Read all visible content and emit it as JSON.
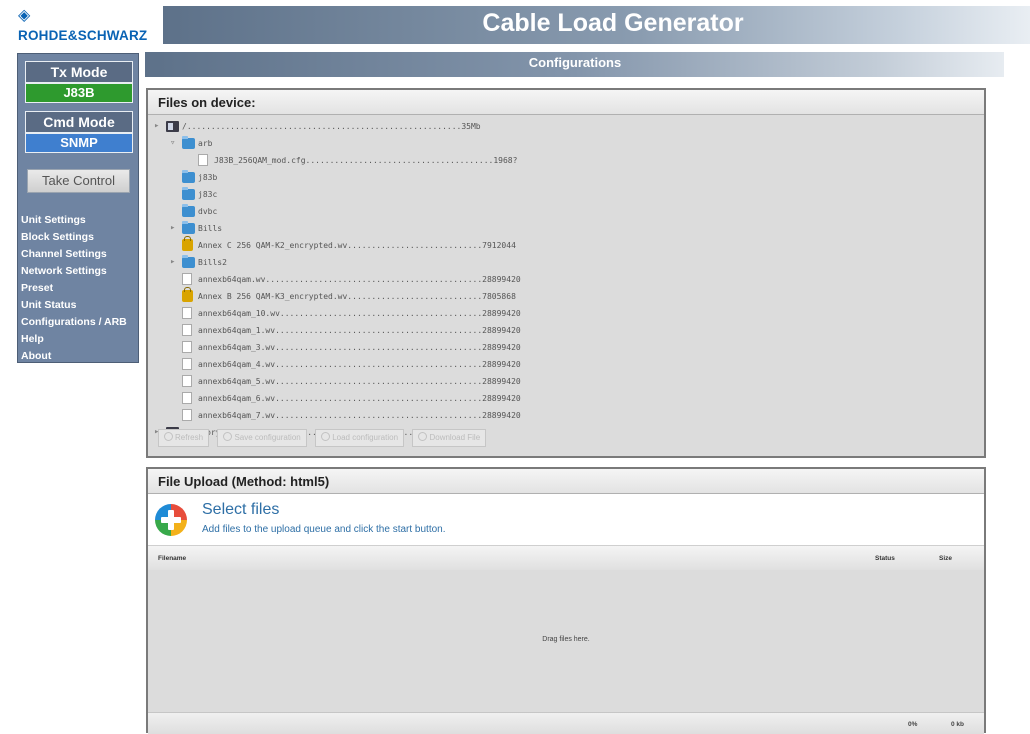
{
  "brand": {
    "logo_text": "ROHDE&SCHWARZ"
  },
  "header": {
    "title": "Cable Load Generator"
  },
  "sidebar": {
    "tx_mode_label": "Tx Mode",
    "tx_mode_value": "J83B",
    "cmd_mode_label": "Cmd Mode",
    "cmd_mode_value": "SNMP",
    "take_control_label": "Take Control",
    "nav": [
      "Unit Settings",
      "Block Settings",
      "Channel Settings",
      "Network Settings",
      "Preset",
      "Unit Status",
      "Configurations / ARB",
      "Help",
      "About"
    ]
  },
  "page": {
    "section_title": "Configurations"
  },
  "files_panel": {
    "title": "Files on device:",
    "tree": [
      {
        "indent": 0,
        "toggle": "▸",
        "icon": "drive",
        "label": "/.........................................................35Mb"
      },
      {
        "indent": 1,
        "toggle": "▿",
        "icon": "folder",
        "label": "arb"
      },
      {
        "indent": 2,
        "toggle": "",
        "icon": "file",
        "label": "J83B_256QAM_mod.cfg.......................................1968?"
      },
      {
        "indent": 1,
        "toggle": "",
        "icon": "folder",
        "label": "j83b"
      },
      {
        "indent": 1,
        "toggle": "",
        "icon": "folder",
        "label": "j83c"
      },
      {
        "indent": 1,
        "toggle": "",
        "icon": "folder",
        "label": "dvbc"
      },
      {
        "indent": 1,
        "toggle": "▸",
        "icon": "folder",
        "label": "Bills"
      },
      {
        "indent": 1,
        "toggle": "",
        "icon": "lock",
        "label": "Annex C 256 QAM-K2_encrypted.wv............................7912044"
      },
      {
        "indent": 1,
        "toggle": "▸",
        "icon": "folder",
        "label": "Bills2"
      },
      {
        "indent": 1,
        "toggle": "",
        "icon": "file",
        "label": "annexb64qam.wv.............................................28899420"
      },
      {
        "indent": 1,
        "toggle": "",
        "icon": "lock",
        "label": "Annex B 256 QAM-K3_encrypted.wv............................7805868"
      },
      {
        "indent": 1,
        "toggle": "",
        "icon": "file",
        "label": "annexb64qam_10.wv..........................................28899420"
      },
      {
        "indent": 1,
        "toggle": "",
        "icon": "file",
        "label": "annexb64qam_1.wv...........................................28899420"
      },
      {
        "indent": 1,
        "toggle": "",
        "icon": "file",
        "label": "annexb64qam_3.wv...........................................28899420"
      },
      {
        "indent": 1,
        "toggle": "",
        "icon": "file",
        "label": "annexb64qam_4.wv...........................................28899420"
      },
      {
        "indent": 1,
        "toggle": "",
        "icon": "file",
        "label": "annexb64qam_5.wv...........................................28899420"
      },
      {
        "indent": 1,
        "toggle": "",
        "icon": "file",
        "label": "annexb64qam_6.wv...........................................28899420"
      },
      {
        "indent": 1,
        "toggle": "",
        "icon": "file",
        "label": "annexb64qam_7.wv...........................................28899420"
      },
      {
        "indent": 0,
        "toggle": "▸",
        "icon": "drive",
        "label": "/Factory..................................................0Mb"
      }
    ],
    "buttons": [
      "Refresh",
      "Save configuration",
      "Load configuration",
      "Download File"
    ]
  },
  "upload_panel": {
    "title": "File Upload (Method: html5)",
    "select_title": "Select files",
    "select_sub": "Add files to the upload queue and click the start button.",
    "col_filename": "Filename",
    "col_status": "Status",
    "col_size": "Size",
    "drop_text": "Drag files here.",
    "footer_percent": "0%",
    "footer_size": "0 kb"
  },
  "colors": {
    "tx_mode_bg": "#2e9a2e",
    "cmd_mode_bg": "#3f7fcf",
    "brand_blue": "#0a63b4",
    "sidebar_bg": "#6f84a2"
  }
}
